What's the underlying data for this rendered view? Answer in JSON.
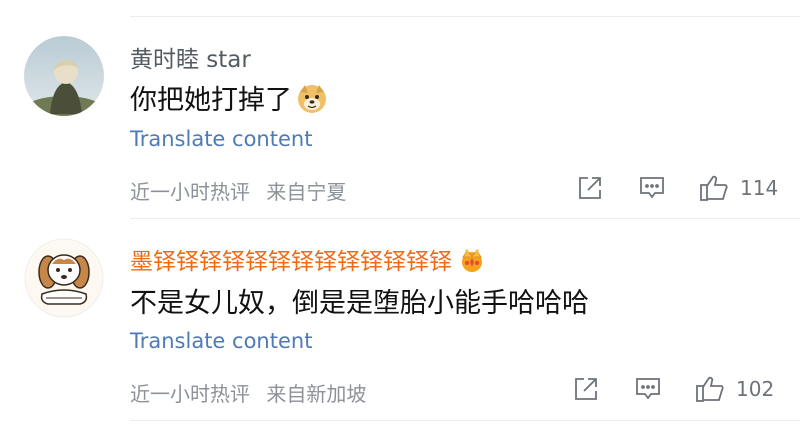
{
  "comments": [
    {
      "username": "黄时睦 star",
      "text": "你把她打掉了",
      "translate_label": "Translate content",
      "time": "近一小时热评",
      "location": "来自宁夏",
      "likes": "114",
      "emoji_icon": "doge-emoji-icon",
      "avatar_icon": "landscape-avatar"
    },
    {
      "username": "墨铎铎铎铎铎铎铎铎铎铎铎铎铎",
      "text": "不是女儿奴，倒是是堕胎小能手哈哈哈",
      "translate_label": "Translate content",
      "time": "近一小时热评",
      "location": "来自新加坡",
      "likes": "102",
      "badge_icon": "crown-badge-icon",
      "avatar_icon": "dog-cartoon-avatar"
    }
  ],
  "colors": {
    "username_default": "#555b62",
    "username_vip": "#f26a12",
    "translate_link": "#4e7bb4",
    "meta_text": "#8d9299"
  }
}
